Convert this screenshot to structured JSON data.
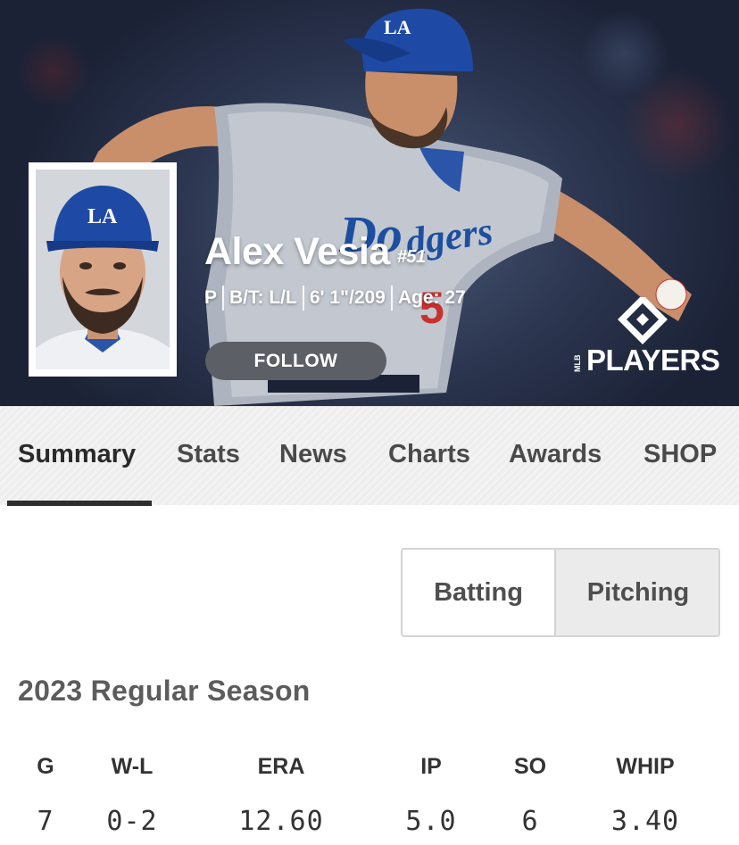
{
  "player": {
    "name": "Alex Vesia",
    "number": "#51",
    "position": "P",
    "bats_throws": "B/T: L/L",
    "height_weight": "6' 1\"/209",
    "age": "Age: 27"
  },
  "hero": {
    "follow_label": "FOLLOW",
    "brand_logo_text": "PLAYERS",
    "brand_logo_small": "MLB",
    "cap_logo_text": "LA"
  },
  "tabs": [
    {
      "label": "Summary",
      "active": true
    },
    {
      "label": "Stats",
      "active": false
    },
    {
      "label": "News",
      "active": false
    },
    {
      "label": "Charts",
      "active": false
    },
    {
      "label": "Awards",
      "active": false
    },
    {
      "label": "SHOP",
      "active": false
    }
  ],
  "toggle": {
    "batting_label": "Batting",
    "pitching_label": "Pitching",
    "selected": "Pitching"
  },
  "season": {
    "title": "2023 Regular Season",
    "columns": [
      "G",
      "W-L",
      "ERA",
      "IP",
      "SO",
      "WHIP"
    ],
    "values": [
      "7",
      "0-2",
      "12.60",
      "5.0",
      "6",
      "3.40"
    ]
  },
  "colors": {
    "hero_bg": "#2c3650",
    "follow_button": "#5c5f66",
    "tab_underline": "#2d2d2d",
    "toggle_selected_bg": "#ebebeb",
    "dodger_blue": "#1d4fa0"
  }
}
